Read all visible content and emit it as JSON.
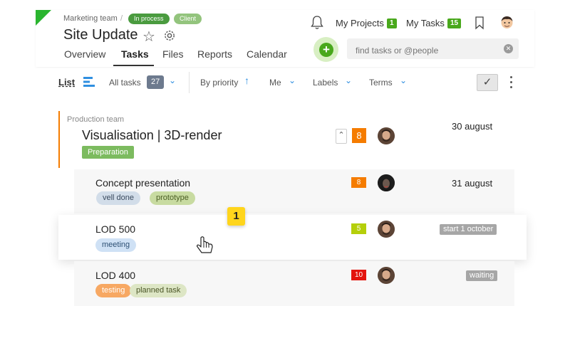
{
  "header": {
    "breadcrumb_team": "Marketing team",
    "breadcrumb_sep": "/",
    "status_pill": "In process",
    "client_pill": "Client",
    "title": "Site Update",
    "my_projects_label": "My Projects",
    "my_projects_count": "1",
    "my_tasks_label": "My Tasks",
    "my_tasks_count": "15",
    "search_placeholder": "find tasks or @people",
    "add_button_icon": "+"
  },
  "tabs": [
    {
      "label": "Overview"
    },
    {
      "label": "Tasks"
    },
    {
      "label": "Files"
    },
    {
      "label": "Reports"
    },
    {
      "label": "Calendar"
    }
  ],
  "toolbar": {
    "list_label": "List",
    "all_tasks_label": "All tasks",
    "all_tasks_count": "27",
    "priority_label": "By priority",
    "me_label": "Me",
    "labels_label": "Labels",
    "terms_label": "Terms"
  },
  "group": {
    "team_label": "Production team",
    "title": "Visualisation | 3D-render",
    "tag": "Preparation",
    "priority": "8",
    "date": "30 august"
  },
  "tasks": [
    {
      "title": "Concept presentation",
      "priority": "8",
      "date": "31 august",
      "tags": [
        "vell done",
        "prototype"
      ]
    },
    {
      "title": "LOD 500",
      "priority": "5",
      "date": "start 1 october",
      "tags": [
        "meeting"
      ]
    },
    {
      "title": "LOD 400",
      "priority": "10",
      "date": "waiting",
      "tags": [
        "testing",
        "planned task"
      ]
    }
  ],
  "notification_badge": "1",
  "colors": {
    "accent_green": "#49a81c",
    "orange": "#f57c00",
    "lime": "#b5cf0a",
    "red": "#e3140e",
    "blue_link": "#2f8fe0",
    "badge_yellow": "#ffd51c"
  }
}
